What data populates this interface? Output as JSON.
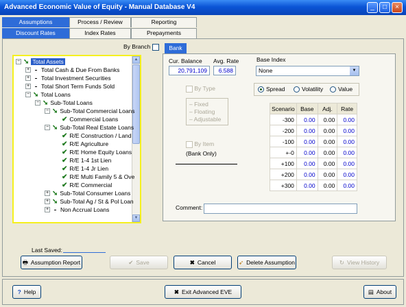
{
  "window": {
    "title": "Advanced Economic Value of Equity - Manual Database V4",
    "buttons": {
      "min": "_",
      "max": "□",
      "close": "×"
    }
  },
  "tabs_top": [
    "Assumptions",
    "Process / Review",
    "Reporting"
  ],
  "tabs_sub": [
    "Discount Rates",
    "Index Rates",
    "Prepayments"
  ],
  "by_branch_label": "By Branch",
  "bank_tab_label": "Bank",
  "tree": [
    {
      "label": "Total Assets",
      "sel": true
    },
    {
      "label": "Total Cash & Due From Banks"
    },
    {
      "label": "Total Investment Securities"
    },
    {
      "label": "Total Short Term Funds Sold"
    },
    {
      "label": "Total Loans"
    },
    {
      "label": "Sub-Total Loans"
    },
    {
      "label": "Sub-Total Commercial Loans"
    },
    {
      "label": "Commercial Loans"
    },
    {
      "label": "Sub-Total Real Estate Loans"
    },
    {
      "label": "R/E Construction / Land"
    },
    {
      "label": "R/E Agriculture"
    },
    {
      "label": "R/E Home Equity Loans"
    },
    {
      "label": "R/E 1-4 1st Lien"
    },
    {
      "label": "R/E 1-4 Jr Lien"
    },
    {
      "label": "R/E Multi Family 5 & Ove"
    },
    {
      "label": "R/E Commercial"
    },
    {
      "label": "Sub-Total Consumer Loans"
    },
    {
      "label": "Sub-Total Ag / St & Pol Loan"
    },
    {
      "label": "Non Accrual Loans"
    }
  ],
  "cur_balance": {
    "label": "Cur. Balance",
    "value": "20,791,109"
  },
  "avg_rate": {
    "label": "Avg. Rate",
    "value": "6.588"
  },
  "base_index": {
    "label": "Base Index",
    "value": "None"
  },
  "by_type": {
    "label": "By Type",
    "options": [
      "Fixed",
      "Floating",
      "Adjustable"
    ]
  },
  "by_item": {
    "label": "By Item",
    "note": "(Bank Only)"
  },
  "radios": {
    "spread": "Spread",
    "volatility": "Volatility",
    "value": "Value"
  },
  "grid": {
    "headers": [
      "Scenario",
      "Base",
      "Adj.",
      "Rate"
    ],
    "rows": [
      {
        "scenario": "-300",
        "base": "0.00",
        "adj": "0.00",
        "rate": "0.00"
      },
      {
        "scenario": "-200",
        "base": "0.00",
        "adj": "0.00",
        "rate": "0.00"
      },
      {
        "scenario": "-100",
        "base": "0.00",
        "adj": "0.00",
        "rate": "0.00"
      },
      {
        "scenario": "+-0",
        "base": "0.00",
        "adj": "0.00",
        "rate": "0.00"
      },
      {
        "scenario": "+100",
        "base": "0.00",
        "adj": "0.00",
        "rate": "0.00"
      },
      {
        "scenario": "+200",
        "base": "0.00",
        "adj": "0.00",
        "rate": "0.00"
      },
      {
        "scenario": "+300",
        "base": "0.00",
        "adj": "0.00",
        "rate": "0.00"
      }
    ]
  },
  "comment_label": "Comment:",
  "last_saved_label": "Last Saved:",
  "buttons": {
    "assumption_report": "Assumption Report",
    "save": "Save",
    "cancel": "Cancel",
    "delete": "Delete Assumption",
    "view_history": "View History",
    "help": "Help",
    "exit": "Exit Advanced EVE",
    "about": "About"
  }
}
